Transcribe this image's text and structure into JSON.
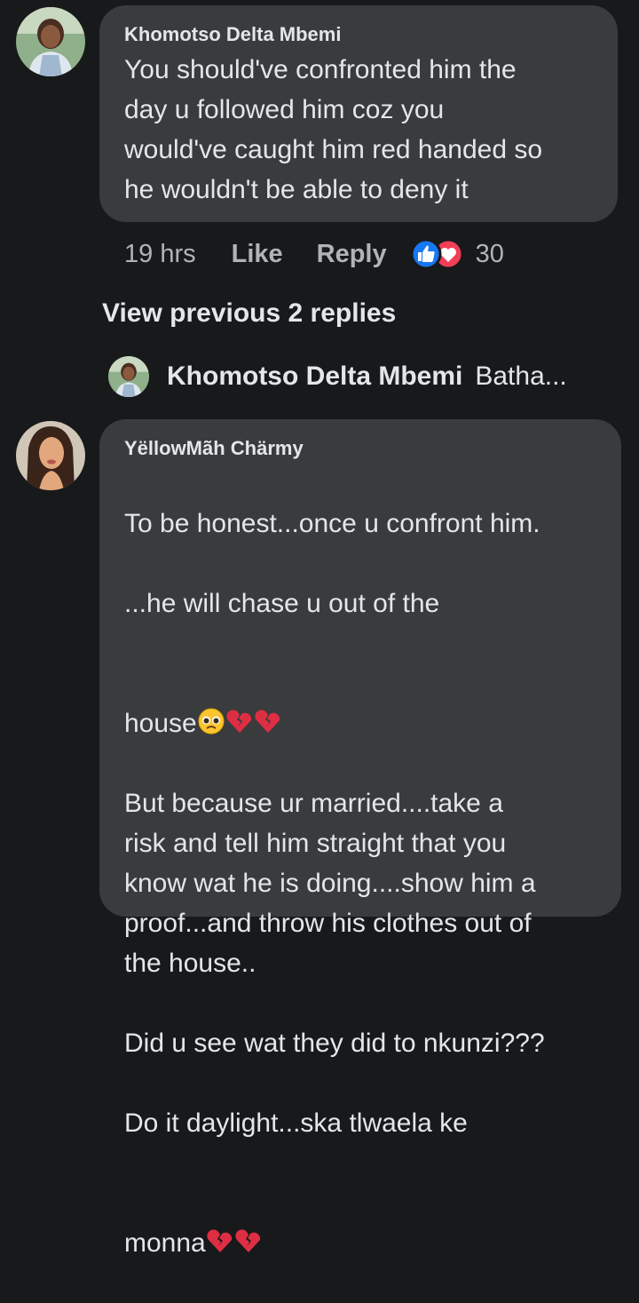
{
  "comment1": {
    "author": "Khomotso Delta Mbemi",
    "text": "You should've confronted him the\nday u followed him coz you\nwould've caught him red handed so\nhe wouldn't be able to deny it",
    "time": "19 hrs",
    "like_label": "Like",
    "reply_label": "Reply",
    "reaction_count": "30",
    "reaction_icons": [
      "like-reaction-icon",
      "love-reaction-icon"
    ]
  },
  "view_previous": "View previous 2 replies",
  "reply_preview": {
    "author": "Khomotso Delta Mbemi",
    "text": "Batha..."
  },
  "comment2": {
    "author": "YëllowMãh Chärmy",
    "line1": "To be honest...once u confront him.",
    "line2": "...he will chase u out of the",
    "line3": "house",
    "line4_7": "But because ur married....take a\nrisk and tell him straight that you\nknow wat he is doing....show him a\nproof...and throw his clothes out of\nthe house..",
    "line8": "Did u see wat they did to nkunzi???",
    "line9": "Do it daylight...ska tlwaela ke",
    "line10": "monna",
    "emoji_after_house": [
      "pleading-face-emoji",
      "broken-heart-emoji",
      "broken-heart-emoji"
    ],
    "emoji_after_monna": [
      "broken-heart-emoji",
      "broken-heart-emoji"
    ]
  },
  "colors": {
    "background": "#18191a",
    "bubble": "#3a3b3c",
    "text": "#e4e6eb",
    "secondary_text": "#b0b3b8",
    "like_blue": "#1877f2",
    "love_red": "#f33e58"
  }
}
